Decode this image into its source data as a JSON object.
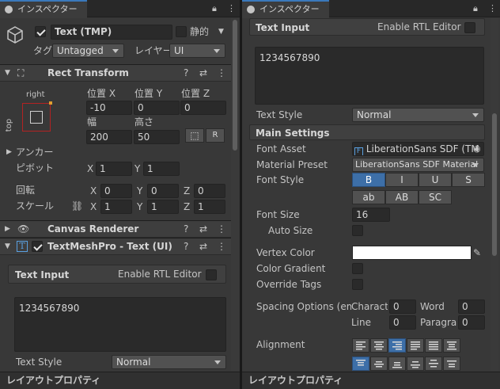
{
  "left": {
    "tab": "インスペクター",
    "object": {
      "name": "Text (TMP)",
      "static_label": "静的",
      "tag_label": "タグ",
      "tag_value": "Untagged",
      "layer_label": "レイヤー",
      "layer_value": "UI"
    },
    "rect": {
      "title": "Rect Transform",
      "anchor_h": "right",
      "anchor_v": "top",
      "pos_x_label": "位置 X",
      "pos_y_label": "位置 Y",
      "pos_z_label": "位置 Z",
      "pos_x": "-10",
      "pos_y": "0",
      "pos_z": "0",
      "width_label": "幅",
      "height_label": "高さ",
      "width": "200",
      "height": "50",
      "r_label": "R",
      "anchor_label": "アンカー",
      "pivot_label": "ピボット",
      "pivot_x": "1",
      "pivot_y": "1",
      "rotation_label": "回転",
      "rot_x": "0",
      "rot_y": "0",
      "rot_z": "0",
      "scale_label": "スケール",
      "scale_x": "1",
      "scale_y": "1",
      "scale_z": "1",
      "x": "X",
      "y": "Y",
      "z": "Z"
    },
    "canvas_renderer": "Canvas Renderer",
    "tmp_title": "TextMeshPro - Text (UI)",
    "text_input": {
      "title": "Text Input",
      "rtl": "Enable RTL Editor",
      "value": "1234567890",
      "style_label": "Text Style",
      "style_value": "Normal"
    },
    "footer": "レイアウトプロパティ"
  },
  "right": {
    "tab": "インスペクター",
    "text_input": {
      "title": "Text Input",
      "rtl": "Enable RTL Editor",
      "value": "1234567890",
      "style_label": "Text Style",
      "style_value": "Normal"
    },
    "main_settings": "Main Settings",
    "font_asset_label": "Font Asset",
    "font_asset_value": "LiberationSans SDF (TM",
    "material_label": "Material Preset",
    "material_value": "LiberationSans SDF Material",
    "font_style_label": "Font Style",
    "style_b": "B",
    "style_i": "I",
    "style_u": "U",
    "style_s": "S",
    "style_ab": "ab",
    "style_AB": "AB",
    "style_sc": "SC",
    "font_size_label": "Font Size",
    "font_size": "16",
    "auto_size_label": "Auto Size",
    "vertex_color_label": "Vertex Color",
    "vertex_color": "#ffffff",
    "color_gradient_label": "Color Gradient",
    "override_tags_label": "Override Tags",
    "spacing_label": "Spacing Options (em",
    "char_label": "Charact",
    "char_value": "0",
    "word_label": "Word",
    "word_value": "0",
    "line_label": "Line",
    "line_value": "0",
    "para_label": "Paragra",
    "para_value": "0",
    "alignment_label": "Alignment",
    "footer": "レイアウトプロパティ"
  },
  "colors": {
    "accent": "#3a79bb",
    "selected_button": "#3d6fa8",
    "anchor_outline": "#b22222"
  }
}
